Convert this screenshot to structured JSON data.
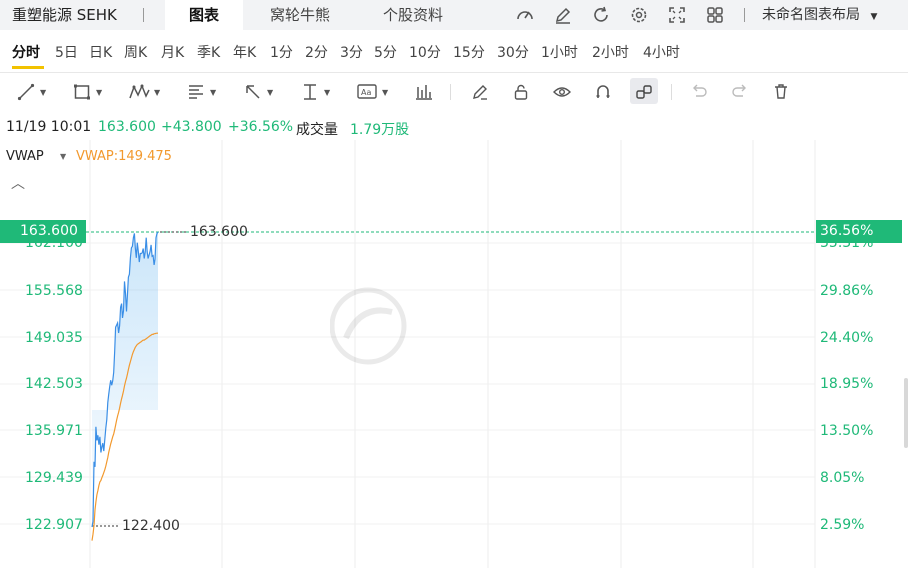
{
  "header": {
    "stock_name": "重塑能源 SEHK",
    "tabs": [
      {
        "label": "图表",
        "active": true
      },
      {
        "label": "窝轮牛熊",
        "active": false
      },
      {
        "label": "个股资料",
        "active": false
      }
    ],
    "icons": [
      "speedometer-icon",
      "edit-icon",
      "refresh-icon",
      "settings-icon",
      "fullscreen-icon",
      "layout-grid-icon"
    ],
    "layout_label": "未命名图表布局"
  },
  "periods": [
    {
      "label": "分时",
      "active": true
    },
    {
      "label": "5日"
    },
    {
      "label": "日K"
    },
    {
      "label": "周K"
    },
    {
      "label": "月K"
    },
    {
      "label": "季K"
    },
    {
      "label": "年K"
    },
    {
      "label": "1分"
    },
    {
      "label": "2分"
    },
    {
      "label": "3分"
    },
    {
      "label": "5分"
    },
    {
      "label": "10分"
    },
    {
      "label": "15分"
    },
    {
      "label": "30分"
    },
    {
      "label": "1小时"
    },
    {
      "label": "2小时"
    },
    {
      "label": "4小时"
    }
  ],
  "tools": [
    "line-tool-icon",
    "rectangle-tool-icon",
    "pattern-tool-icon",
    "fib-tool-icon",
    "arrow-tool-icon",
    "measure-tool-icon",
    "text-tool-icon",
    "bar-tool-icon",
    "pen-icon",
    "lock-icon",
    "eye-icon",
    "magnet-icon",
    "link-icon",
    "undo-icon",
    "redo-icon",
    "trash-icon"
  ],
  "quote": {
    "time": "11/19 10:01",
    "price": "163.600",
    "change": "+43.800",
    "change_pct": "+36.56%",
    "volume_label": "成交量",
    "volume": "1.79万股"
  },
  "indicator": {
    "name": "VWAP",
    "value": "VWAP:149.475"
  },
  "colors": {
    "up": "#1fb978",
    "price_line": "#3a8ee6",
    "vwap_line": "#f2992e",
    "active_underline": "#f2c200"
  },
  "chart_data": {
    "type": "line",
    "y_left_ticks": [
      "162.100",
      "155.568",
      "149.035",
      "142.503",
      "135.971",
      "129.439",
      "122.907"
    ],
    "y_right_ticks": [
      "35.31%",
      "29.86%",
      "24.40%",
      "18.95%",
      "13.50%",
      "8.05%",
      "2.59%"
    ],
    "ylim": [
      119.0,
      167.0
    ],
    "current_price_label": "163.600",
    "current_pct_label": "36.56%",
    "high_label": "163.600",
    "low_label": "122.400",
    "high": 163.6,
    "low": 122.4,
    "series": [
      {
        "values": [
          122.4,
          123.2,
          131.5,
          130.8,
          136.4,
          134.5,
          135.2,
          133.9,
          135.0,
          132.8,
          133.6,
          134.1,
          133.0,
          134.6,
          136.2,
          137.4,
          139.8,
          140.9,
          142.0,
          142.9,
          142.2,
          142.8,
          144.0,
          147.0,
          150.3,
          150.6,
          150.9,
          149.5,
          150.5,
          153.1,
          153.6,
          151.6,
          152.6,
          156.7,
          155.0,
          152.5,
          155.0,
          157.3,
          157.7,
          160.0,
          161.4,
          161.6,
          162.8,
          163.4,
          161.4,
          160.0,
          162.1,
          160.9,
          159.4,
          160.6,
          160.6,
          160.7,
          161.3,
          159.9,
          160.8,
          162.8,
          160.8,
          159.9,
          160.4,
          160.9,
          161.8,
          160.2,
          160.3,
          159.0,
          159.8,
          162.8,
          163.4,
          163.6
        ]
      },
      {
        "values": [
          120.5,
          121.4,
          122.6,
          124.8,
          125.9,
          126.9,
          127.5,
          128.2,
          128.7,
          128.9,
          129.3,
          129.6,
          130.0,
          130.4,
          130.9,
          131.5,
          132.1,
          132.8,
          133.4,
          134.0,
          134.5,
          135.0,
          135.4,
          136.0,
          136.6,
          137.3,
          137.9,
          138.4,
          139.0,
          139.7,
          140.3,
          140.8,
          141.4,
          142.1,
          142.7,
          143.2,
          143.8,
          144.4,
          145.0,
          145.5,
          146.0,
          146.5,
          146.9,
          147.2,
          147.5,
          147.7,
          147.9,
          148.0,
          148.1,
          148.2,
          148.3,
          148.4,
          148.5,
          148.5,
          148.6,
          148.7,
          148.8,
          148.9,
          149.0,
          149.1,
          149.2,
          149.3,
          149.3,
          149.4,
          149.4,
          149.45,
          149.47,
          149.475
        ]
      }
    ],
    "grid": true
  }
}
